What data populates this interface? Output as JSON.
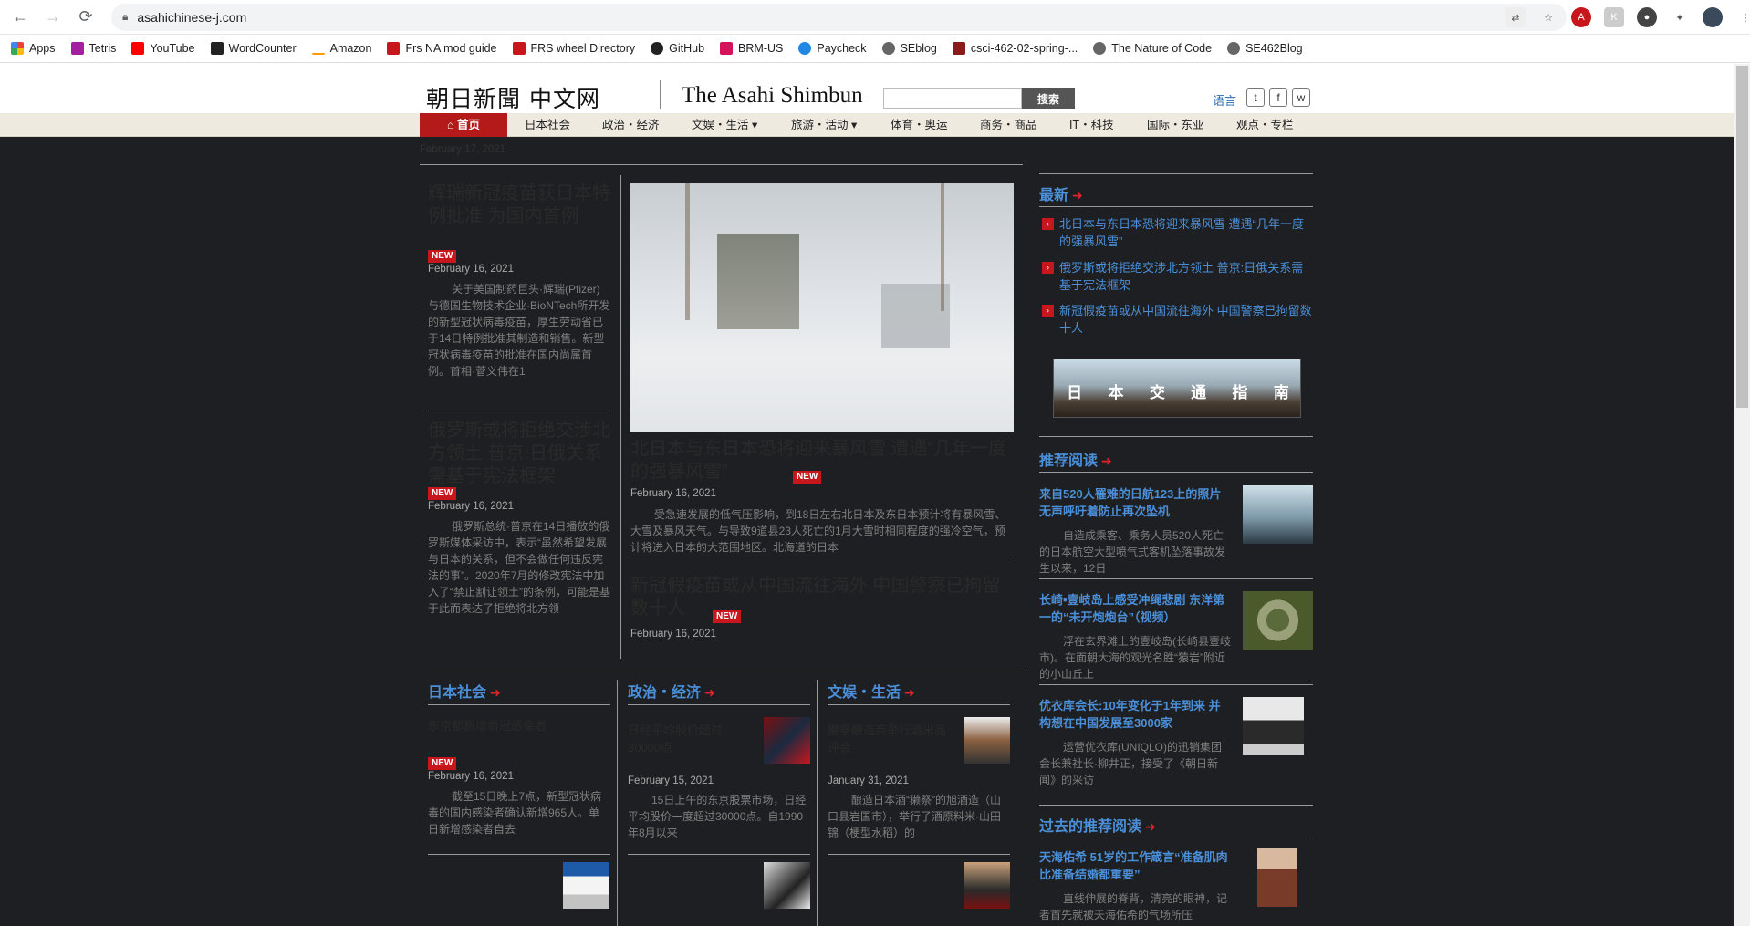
{
  "browser": {
    "url": "asahichinese-j.com",
    "bookmarks": [
      "Apps",
      "Tetris",
      "YouTube",
      "WordCounter",
      "Amazon",
      "Frs NA mod guide",
      "FRS wheel Directory",
      "GitHub",
      "BRM-US",
      "Paycheck",
      "SEblog",
      "csci-462-02-spring-...",
      "The Nature of Code",
      "SE462Blog"
    ]
  },
  "header": {
    "logo_cn": "朝日新聞 中文网",
    "logo_en": "The Asahi Shimbun",
    "search_button": "搜索",
    "lang_label": "语言"
  },
  "nav": {
    "items": [
      "首页",
      "日本社会",
      "政治・经济",
      "文娱・生活 ▾",
      "旅游・活动 ▾",
      "体育・奥运",
      "商务・商品",
      "IT・科技",
      "国际・东亚",
      "观点・专栏"
    ]
  },
  "main": {
    "page_date": "February 17, 2021",
    "left_col": [
      {
        "title": "辉瑞新冠疫苗获日本特例批准 为国内首例",
        "new": "NEW",
        "date": "February 16, 2021",
        "snippet": "关于美国制药巨头·辉瑞(Pfizer)与德国生物技术企业·BioNTech所开发的新型冠状病毒疫苗，厚生劳动省已于14日特例批准其制造和销售。新型冠状病毒疫苗的批准在国内尚属首例。首相·菅义伟在1"
      },
      {
        "title": "俄罗斯或将拒绝交涉北方领土 普京:日俄关系需基于宪法框架",
        "new": "NEW",
        "date": "February 16, 2021",
        "snippet": "俄罗斯总统·普京在14日播放的俄罗斯媒体采访中，表示“虽然希望发展与日本的关系，但不会做任何违反宪法的事”。2020年7月的修改宪法中加入了“禁止割让领土”的条例，可能是基于此而表达了拒绝将北方领"
      }
    ],
    "center": {
      "title": "北日本与东日本恐将迎来暴风雪 遭遇“几年一度的强暴风雪”",
      "new": "NEW",
      "date": "February 16, 2021",
      "snippet": "受急速发展的低气压影响，到18日左右北日本及东日本预计将有暴风雪、大雪及暴风天气。与导致9道县23人死亡的1月大雪时相同程度的强冷空气，预计将进入日本的大范围地区。北海道的日本",
      "second_title": "新冠假疫苗或从中国流往海外 中国警察已拘留数十人",
      "second_new": "NEW",
      "second_date": "February 16, 2021"
    },
    "bottom_sections": [
      {
        "title": "日本社会",
        "item_title": "东京都新增新冠感染者",
        "new": "NEW",
        "date": "February 16, 2021",
        "snippet": "截至15日晚上7点，新型冠状病毒的国内感染者确认新增965人。单日新增感染者自去"
      },
      {
        "title": "政治・经济",
        "item_title": "日经平均股价超过30000点",
        "date": "February 15, 2021",
        "snippet": "15日上午的东京股票市场，日经平均股价一度超过30000点。自1990年8月以来"
      },
      {
        "title": "文娱・生活",
        "item_title": "獭祭酿造商举行酒米品评会",
        "date": "January 31, 2021",
        "snippet": "酿造日本酒“獭祭”的旭酒造（山口县岩国市），举行了酒原料米·山田锦（梗型水稻）的"
      }
    ]
  },
  "sidebar": {
    "latest_title": "最新",
    "latest": [
      "北日本与东日本恐将迎来暴风雪 遭遇“几年一度的强暴风雪”",
      "俄罗斯或将拒绝交涉北方领土 普京:日俄关系需基于宪法框架",
      "新冠假疫苗或从中国流往海外 中国警察已拘留数十人"
    ],
    "banner_chars": [
      "日",
      "本",
      "交",
      "通",
      "指",
      "南"
    ],
    "recommended_title": "推荐阅读",
    "recommended": [
      {
        "title": "来自520人罹难的日航123上的照片 无声呼吁着防止再次坠机",
        "snippet": "自造成乘客、乘务人员520人死亡的日本航空大型喷气式客机坠落事故发生以来，12日"
      },
      {
        "title": "长崎•壹岐岛上感受冲绳悲剧 东洋第一的“未开炮炮台”（视频）",
        "snippet": "浮在玄界滩上的壹岐岛(长崎县壹岐市)。在面朝大海的观光名胜“猿岩”附近的小山丘上"
      },
      {
        "title": "优衣库会长:10年变化于1年到来 并构想在中国发展至3000家",
        "snippet": "运营优衣库(UNIQLO)的迅销集团会长兼社长·柳井正，接受了《朝日新闻》的采访"
      }
    ],
    "past_title": "过去的推荐阅读",
    "past": [
      {
        "title": "天海佑希 51岁的工作箴言“准备肌肉比准备结婚都重要”",
        "snippet": "直线伸展的脊背，清亮的眼神，记者首先就被天海佑希的气场所压"
      }
    ]
  }
}
